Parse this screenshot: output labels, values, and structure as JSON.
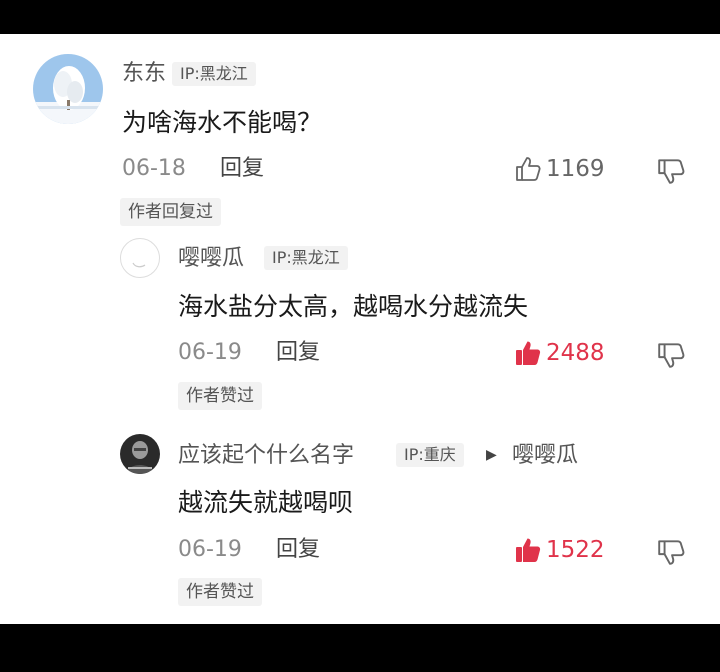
{
  "comments": [
    {
      "author": "东东",
      "ip": "IP:黑龙江",
      "text": "为啥海水不能喝？",
      "date": "06-18",
      "reply_label": "回复",
      "likes": "1169",
      "liked": false,
      "author_tag": "作者回复过",
      "avatar_icon": "snowy-tree-avatar"
    },
    {
      "author": "嘤嘤瓜",
      "ip": "IP:黑龙江",
      "text": "海水盐分太高，越喝水分越流失",
      "date": "06-19",
      "reply_label": "回复",
      "likes": "2488",
      "liked": true,
      "author_tag": "作者赞过",
      "avatar_icon": "blank-circle-avatar"
    },
    {
      "author": "应该起个什么名字",
      "ip": "IP:重庆",
      "reply_to": "嘤嘤瓜",
      "text": "越流失就越喝呗",
      "date": "06-19",
      "reply_label": "回复",
      "likes": "1522",
      "liked": true,
      "author_tag": "作者赞过",
      "avatar_icon": "portrait-avatar"
    }
  ],
  "colors": {
    "like_red": "#e0334a",
    "text_grey": "#8a8a8a",
    "tag_bg": "#f2f2f2"
  }
}
